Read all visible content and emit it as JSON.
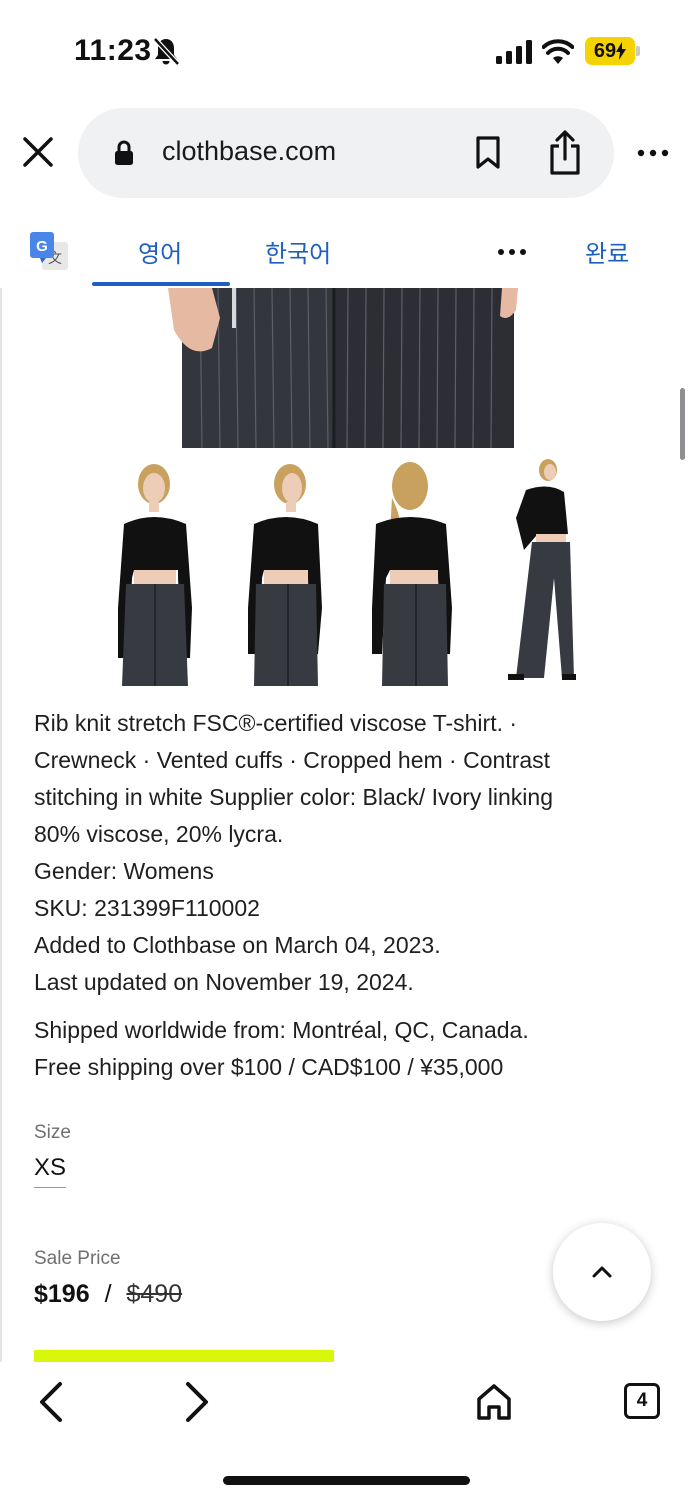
{
  "status_bar": {
    "time": "11:23",
    "battery": "69"
  },
  "browser": {
    "url": "clothbase.com"
  },
  "translate_bar": {
    "source_lang": "영어",
    "target_lang": "한국어",
    "done": "완료"
  },
  "product": {
    "description_lines": [
      "Rib knit stretch FSC®-certified viscose T-shirt. ·",
      "Crewneck · Vented cuffs · Cropped hem · Contrast",
      "stitching in white Supplier color: Black/ Ivory linking",
      "80% viscose, 20% lycra."
    ],
    "gender": "Gender: Womens",
    "sku": "SKU: 231399F110002",
    "added": "Added to Clothbase on March 04, 2023.",
    "updated": "Last updated on November 19, 2024.",
    "shipped_from": "Shipped worldwide from: Montréal, QC, Canada.",
    "free_shipping": "Free shipping over $100 / CAD$100 / ¥35,000",
    "size_label": "Size",
    "size_value": "XS",
    "price_label": "Sale Price",
    "sale_price": "$196",
    "separator": "/",
    "original_price": "$490"
  },
  "toolbar": {
    "tab_count": "4"
  },
  "colors": {
    "accent": "#1f5fbf",
    "cta": "#d8f70a",
    "battery": "#f5d300"
  }
}
